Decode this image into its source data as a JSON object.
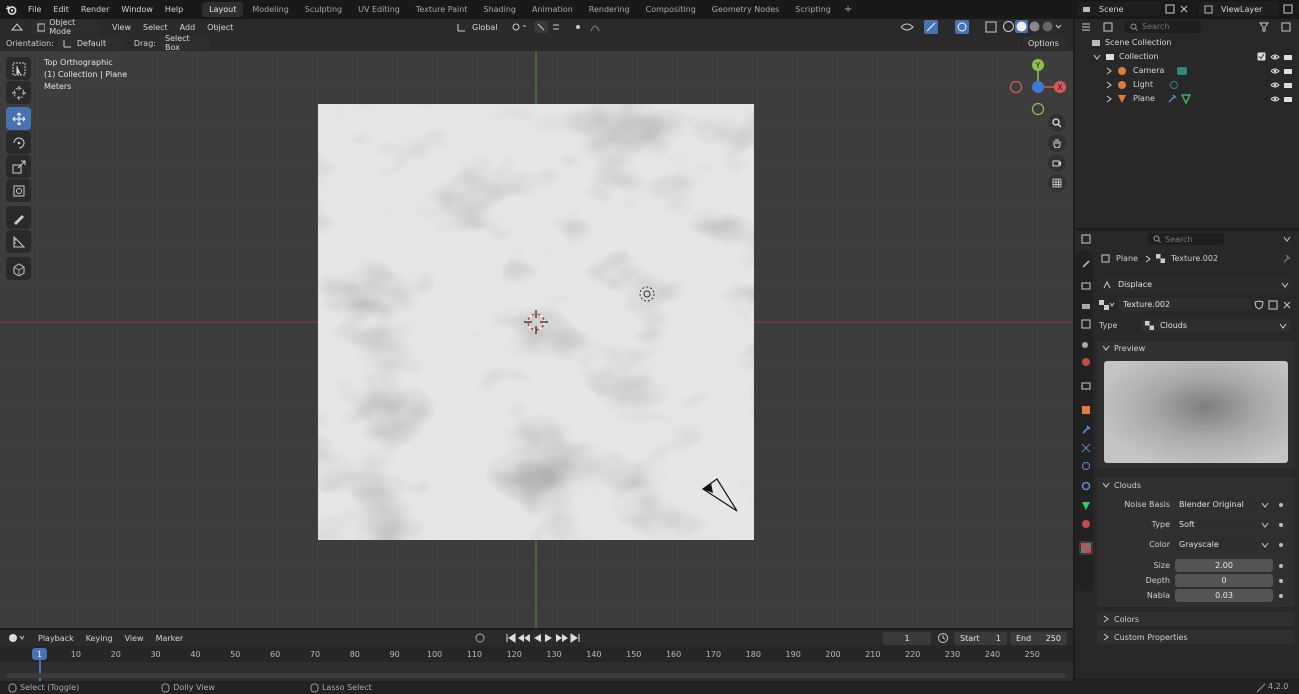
{
  "menu": [
    "File",
    "Edit",
    "Render",
    "Window",
    "Help"
  ],
  "workspaces": [
    "Layout",
    "Modeling",
    "Sculpting",
    "UV Editing",
    "Texture Paint",
    "Shading",
    "Animation",
    "Rendering",
    "Compositing",
    "Geometry Nodes",
    "Scripting"
  ],
  "active_workspace": "Layout",
  "add_workspace": "+",
  "scene": {
    "name": "Scene",
    "view_layer": "ViewLayer"
  },
  "viewport_header": {
    "mode": "Object Mode",
    "menus": [
      "View",
      "Select",
      "Add",
      "Object"
    ],
    "transform": "Global"
  },
  "tool_settings": {
    "orientation_label": "Orientation:",
    "orientation_value": "Default",
    "drag_label": "Drag:",
    "drag_value": "Select Box",
    "options": "Options"
  },
  "viewport_overlay": {
    "view_name": "Top Orthographic",
    "collection": "(1) Collection | Plane",
    "units": "Meters"
  },
  "gizmo": {
    "y": "Y",
    "x": "X"
  },
  "outliner": {
    "search_placeholder": "Search",
    "root": "Scene Collection",
    "collection": "Collection",
    "items": [
      {
        "name": "Camera"
      },
      {
        "name": "Light"
      },
      {
        "name": "Plane"
      }
    ]
  },
  "properties": {
    "search_placeholder": "Search",
    "breadcrumb": {
      "object": "Plane",
      "texture": "Texture.002"
    },
    "modifier": "Displace",
    "texture_name": "Texture.002",
    "type_label": "Type",
    "type_value": "Clouds",
    "preview_panel": "Preview",
    "clouds_panel": "Clouds",
    "fields": [
      {
        "label": "Noise Basis",
        "value": "Blender Original",
        "kind": "dropdown"
      },
      {
        "label": "Type",
        "value": "Soft",
        "kind": "dropdown"
      },
      {
        "label": "Color",
        "value": "Grayscale",
        "kind": "dropdown"
      }
    ],
    "numbers": [
      {
        "label": "Size",
        "value": "2.00"
      },
      {
        "label": "Depth",
        "value": "0"
      },
      {
        "label": "Nabla",
        "value": "0.03"
      }
    ],
    "colors_panel": "Colors",
    "custom_panel": "Custom Properties"
  },
  "timeline": {
    "menus": [
      "Playback",
      "Keying",
      "View",
      "Marker"
    ],
    "current_frame": "1",
    "start_label": "Start",
    "start": "1",
    "end_label": "End",
    "end": "250",
    "ticks": [
      "10",
      "20",
      "30",
      "40",
      "50",
      "60",
      "70",
      "80",
      "90",
      "100",
      "110",
      "120",
      "130",
      "140",
      "150",
      "160",
      "170",
      "180",
      "190",
      "200",
      "210",
      "220",
      "230",
      "240",
      "250"
    ],
    "cursor_frame": "1"
  },
  "status": {
    "left": "Select (Toggle)",
    "middle": "Dolly View",
    "right": "Lasso Select",
    "version": "4.2.0"
  }
}
